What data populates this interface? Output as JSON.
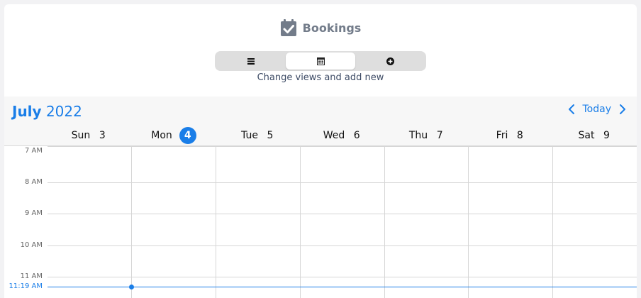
{
  "app": {
    "title": "Bookings",
    "brand_icon": "calendar-check-icon",
    "hint": "Change views and add new"
  },
  "view_switcher": {
    "buttons": [
      {
        "name": "list-view",
        "icon": "list-icon",
        "active": false
      },
      {
        "name": "calendar-view",
        "icon": "calendar-grid-icon",
        "active": true
      },
      {
        "name": "add-new",
        "icon": "plus-circle-icon",
        "active": false
      }
    ]
  },
  "calendar": {
    "month": "July",
    "year": "2022",
    "today_label": "Today",
    "days": [
      {
        "name": "Sun",
        "num": "3",
        "today": false
      },
      {
        "name": "Mon",
        "num": "4",
        "today": true
      },
      {
        "name": "Tue",
        "num": "5",
        "today": false
      },
      {
        "name": "Wed",
        "num": "6",
        "today": false
      },
      {
        "name": "Thu",
        "num": "7",
        "today": false
      },
      {
        "name": "Fri",
        "num": "8",
        "today": false
      },
      {
        "name": "Sat",
        "num": "9",
        "today": false
      }
    ],
    "hours": [
      "7 AM",
      "8 AM",
      "9 AM",
      "10 AM",
      "11 AM"
    ],
    "now_label": "11:19 AM",
    "colors": {
      "accent": "#1a7ee8",
      "brand": "#737c8a"
    }
  }
}
